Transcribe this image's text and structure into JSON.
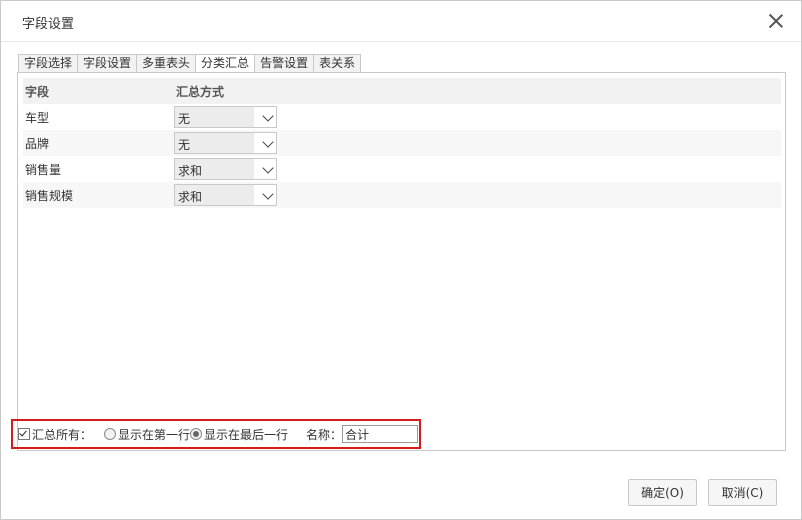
{
  "dialog": {
    "title": "字段设置",
    "close_icon": "close-icon"
  },
  "tabs": [
    {
      "label": "字段选择",
      "active": false
    },
    {
      "label": "字段设置",
      "active": false
    },
    {
      "label": "多重表头",
      "active": false
    },
    {
      "label": "分类汇总",
      "active": true
    },
    {
      "label": "告警设置",
      "active": false
    },
    {
      "label": "表关系",
      "active": false
    }
  ],
  "table": {
    "headers": {
      "field": "字段",
      "method": "汇总方式"
    },
    "rows": [
      {
        "field": "车型",
        "method": "无"
      },
      {
        "field": "品牌",
        "method": "无"
      },
      {
        "field": "销售量",
        "method": "求和"
      },
      {
        "field": "销售规模",
        "method": "求和"
      }
    ]
  },
  "summary": {
    "summarize_all_label": "汇总所有：",
    "summarize_all_checked": true,
    "show_first_label": "显示在第一行",
    "show_last_label": "显示在最后一行",
    "selected_position": "last",
    "name_label": "名称：",
    "name_value": "合计"
  },
  "buttons": {
    "ok": "确定(O)",
    "cancel": "取消(C)"
  },
  "colors": {
    "highlight_border": "#d71a1a",
    "header_bg": "#f2f2f2"
  }
}
